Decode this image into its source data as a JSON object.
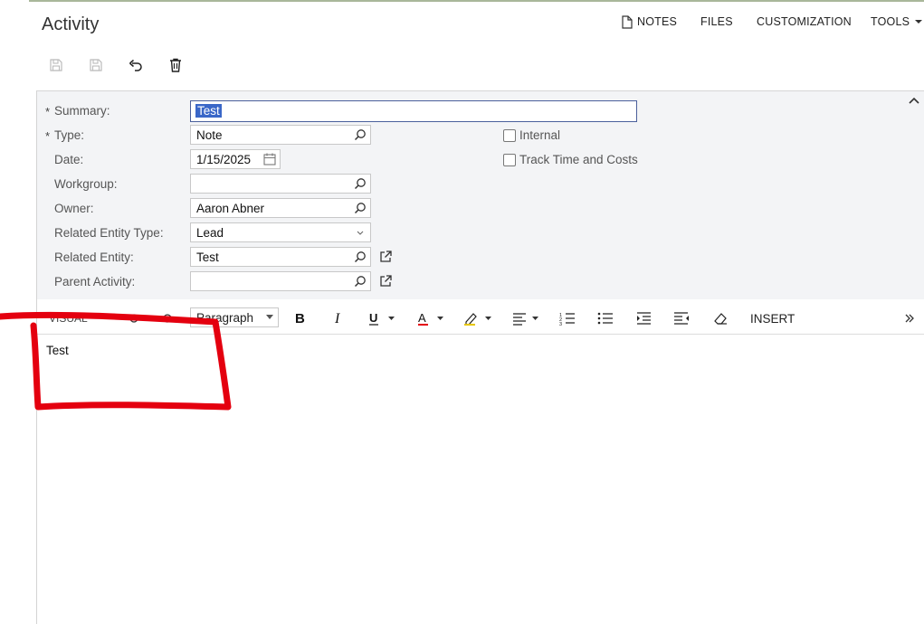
{
  "header": {
    "title": "Activity",
    "menu": {
      "notes": "NOTES",
      "files": "FILES",
      "customization": "CUSTOMIZATION",
      "tools": "TOOLS"
    }
  },
  "toolbar": {
    "icons": [
      "save-close-icon",
      "save-icon",
      "undo-icon",
      "delete-icon"
    ]
  },
  "form": {
    "summary": {
      "label": "Summary:",
      "value": "Test",
      "required": "*"
    },
    "type": {
      "label": "Type:",
      "value": "Note",
      "required": "*"
    },
    "date": {
      "label": "Date:",
      "value": "1/15/2025"
    },
    "workgroup": {
      "label": "Workgroup:",
      "value": ""
    },
    "owner": {
      "label": "Owner:",
      "value": "Aaron Abner"
    },
    "related_entity_type": {
      "label": "Related Entity Type:",
      "value": "Lead"
    },
    "related_entity": {
      "label": "Related Entity:",
      "value": "Test"
    },
    "parent_activity": {
      "label": "Parent Activity:",
      "value": ""
    },
    "internal": {
      "label": "Internal",
      "checked": false
    },
    "track_time": {
      "label": "Track Time and Costs",
      "checked": false
    }
  },
  "editor": {
    "mode": "VISUAL",
    "format": "Paragraph",
    "insert": "INSERT",
    "content": "Test"
  },
  "colors": {
    "accent_line": "#a9b79a",
    "selection": "#3a67c8",
    "annotation": "#e4000f",
    "form_bg": "#f3f4f6"
  }
}
